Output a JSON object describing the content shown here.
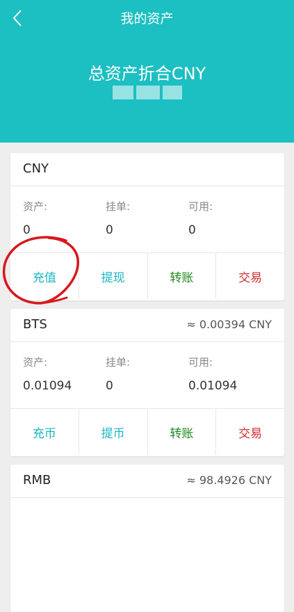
{
  "header": {
    "title": "我的资产",
    "total_label": "总资产折合CNY",
    "bg_color": "#1cbfc2"
  },
  "labels": {
    "asset": "资产:",
    "orders": "挂单:",
    "available": "可用:"
  },
  "cards": [
    {
      "name": "CNY",
      "approx": "",
      "asset": "0",
      "orders": "0",
      "available": "0",
      "actions": [
        "充值",
        "提现",
        "转账",
        "交易"
      ]
    },
    {
      "name": "BTS",
      "approx": "≈ 0.00394 CNY",
      "asset": "0.01094",
      "orders": "0",
      "available": "0.01094",
      "actions": [
        "充币",
        "提币",
        "转账",
        "交易"
      ]
    },
    {
      "name": "RMB",
      "approx": "≈ 98.4926 CNY"
    }
  ],
  "icons": {
    "back": "chevron-left-icon"
  }
}
